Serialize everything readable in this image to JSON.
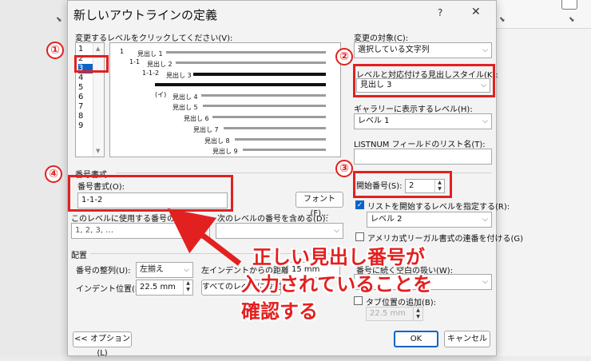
{
  "dialog": {
    "title": "新しいアウトラインの定義",
    "help": "?",
    "close": "✕"
  },
  "level_list": {
    "label": "変更するレベルをクリックしてください(V):",
    "items": [
      "1",
      "2",
      "3",
      "4",
      "5",
      "6",
      "7",
      "8",
      "9"
    ],
    "selected": "3"
  },
  "preview": {
    "rows": [
      {
        "num": "1",
        "text": "見出し 1"
      },
      {
        "num": "1-1",
        "text": "見出し 2"
      },
      {
        "num": "1-1-2",
        "text": "見出し 3"
      },
      {
        "num": "(イ)",
        "text": "見出し 4"
      },
      {
        "num": "",
        "text": "見出し 5"
      },
      {
        "num": "",
        "text": "見出し 6"
      },
      {
        "num": "",
        "text": "見出し 7"
      },
      {
        "num": "",
        "text": "見出し 8"
      },
      {
        "num": "",
        "text": "見出し 9"
      }
    ]
  },
  "right_panel": {
    "apply_to_label": "変更の対象(C):",
    "apply_to_value": "選択している文字列",
    "link_style_label": "レベルと対応付ける見出しスタイル(K):",
    "link_style_value": "見出し 3",
    "gallery_level_label": "ギャラリーに表示するレベル(H):",
    "gallery_level_value": "レベル 1",
    "listnum_label": "LISTNUM フィールドのリスト名(T):",
    "listnum_value": "",
    "start_at_label": "開始番号(S):",
    "start_at_value": "2",
    "restart_label": "リストを開始するレベルを指定する(R):",
    "restart_value": "レベル 2",
    "legal_label": "アメリカ式リーガル書式の連番を付ける(G)",
    "tab_stop_label": "タブ位置の追加(B):",
    "tab_stop_value": "22.5 mm"
  },
  "number_format": {
    "section": "番号書式",
    "format_label": "番号書式(O):",
    "format_value": "1-1-2",
    "font_button": "フォント(F)...",
    "style_label": "このレベルに使用する番号の種類(N):",
    "style_value": "1, 2, 3, …",
    "include_label": "次のレベルの番号を含める(D):"
  },
  "position": {
    "section": "配置",
    "align_label": "番号の整列(U):",
    "align_value": "左揃え",
    "aligned_at_label": "左インデントからの距離(A):",
    "aligned_at_value": "15 mm",
    "indent_label": "インデント位置(I):",
    "indent_value": "22.5 mm",
    "all_levels_button": "すべてのレベルに設定(E)...",
    "follow_label": "番号に続く空白の扱い(W):"
  },
  "buttons": {
    "options": "<< オプション(L)",
    "ok": "OK",
    "cancel": "キャンセル"
  },
  "annotations": {
    "n1": "①",
    "n2": "②",
    "n3": "③",
    "n4": "④",
    "callout_line1": "正しい見出し番号が",
    "callout_line2": "入力されていることを",
    "callout_line3": "確認する",
    "color": "#e32020"
  }
}
